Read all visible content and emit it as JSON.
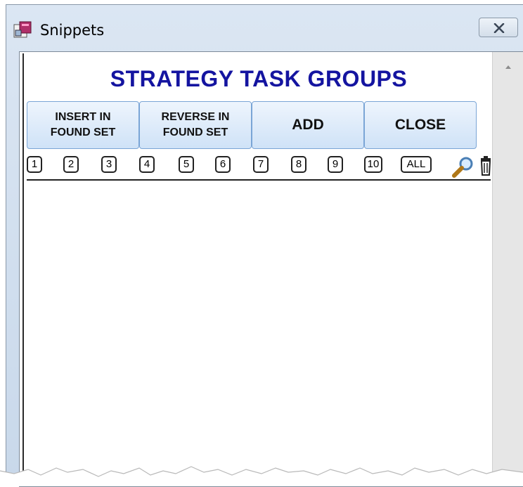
{
  "window": {
    "title": "Snippets",
    "icon": "snippets-app-icon"
  },
  "main": {
    "heading": "STRATEGY TASK GROUPS",
    "buttons": {
      "insert": "INSERT IN\nFOUND SET",
      "reverse": "REVERSE IN\nFOUND SET",
      "add": "ADD",
      "close": "CLOSE"
    },
    "group_tabs": [
      "1",
      "2",
      "3",
      "4",
      "5",
      "6",
      "7",
      "8",
      "9",
      "10",
      "ALL"
    ],
    "icons": [
      "search-icon",
      "trash-icon"
    ]
  },
  "colors": {
    "heading": "#1414a0",
    "button_border": "#7aa5d6",
    "button_fill": "#cfe2f7"
  }
}
